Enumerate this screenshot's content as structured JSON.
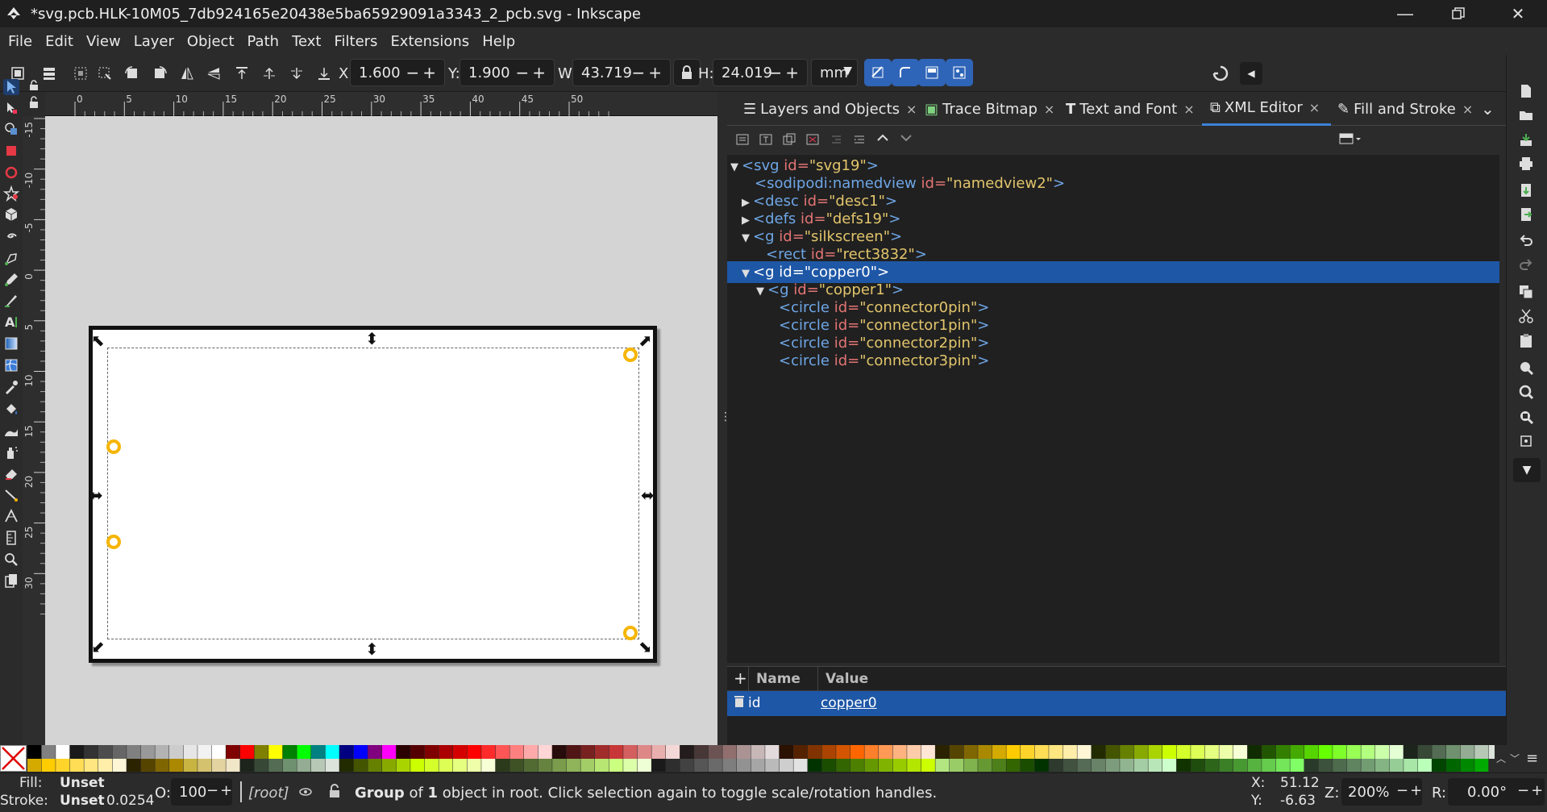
{
  "window": {
    "title": "*svg.pcb.HLK-10M05_7db924165e20438e5ba65929091a3343_2_pcb.svg - Inkscape"
  },
  "menu": [
    "File",
    "Edit",
    "View",
    "Layer",
    "Object",
    "Path",
    "Text",
    "Filters",
    "Extensions",
    "Help"
  ],
  "toolbar": {
    "x_label": "X:",
    "x_value": "1.600",
    "y_label": "Y:",
    "y_value": "1.900",
    "w_label": "W:",
    "w_value": "43.719",
    "h_label": "H:",
    "h_value": "24.019",
    "unit": "mm",
    "plusminus": "−+"
  },
  "ruler": {
    "h_ticks": [
      "0",
      "5",
      "10",
      "15",
      "20",
      "25",
      "30",
      "35",
      "40",
      "45",
      "50"
    ],
    "v_ticks": [
      "-15",
      "-10",
      "-5",
      "0",
      "5",
      "10",
      "15",
      "20",
      "25",
      "30"
    ]
  },
  "dock": {
    "tabs": [
      {
        "label": "Layers and Objects",
        "icon": "layers-icon"
      },
      {
        "label": "Trace Bitmap",
        "icon": "trace-bitmap-icon"
      },
      {
        "label": "Text and Font",
        "icon": "text-font-icon"
      },
      {
        "label": "XML Editor",
        "icon": "xml-editor-icon",
        "active": true
      },
      {
        "label": "Fill and Stroke",
        "icon": "fill-stroke-icon"
      }
    ],
    "close_glyph": "×",
    "more_glyph": "⌄",
    "xml_tree": [
      {
        "tag": "<svg",
        "attr": "id",
        "val": "\"svg19\"",
        "end": ">",
        "arrow": "▼"
      },
      {
        "tag": "<sodipodi:namedview",
        "attr": "id",
        "val": "\"namedview2\"",
        "end": ">",
        "arrow": ""
      },
      {
        "tag": "<desc",
        "attr": "id",
        "val": "\"desc1\"",
        "end": ">",
        "arrow": "▶"
      },
      {
        "tag": "<defs",
        "attr": "id",
        "val": "\"defs19\"",
        "end": ">",
        "arrow": "▶"
      },
      {
        "tag": "<g",
        "attr": "id",
        "val": "\"silkscreen\"",
        "end": ">",
        "arrow": "▼"
      },
      {
        "tag": "<rect",
        "attr": "id",
        "val": "\"rect3832\"",
        "end": ">",
        "arrow": ""
      },
      {
        "tag": "<g",
        "attr": "id",
        "val": "\"copper0\"",
        "end": ">",
        "arrow": "▼",
        "selected": true
      },
      {
        "tag": "<g",
        "attr": "id",
        "val": "\"copper1\"",
        "end": ">",
        "arrow": "▼"
      },
      {
        "tag": "<circle",
        "attr": "id",
        "val": "\"connector0pin\"",
        "end": ">",
        "arrow": ""
      },
      {
        "tag": "<circle",
        "attr": "id",
        "val": "\"connector1pin\"",
        "end": ">",
        "arrow": ""
      },
      {
        "tag": "<circle",
        "attr": "id",
        "val": "\"connector2pin\"",
        "end": ">",
        "arrow": ""
      },
      {
        "tag": "<circle",
        "attr": "id",
        "val": "\"connector3pin\"",
        "end": ">",
        "arrow": ""
      }
    ],
    "attributes": {
      "add": "+",
      "col_name": "Name",
      "col_value": "Value",
      "rows": [
        {
          "name": "id",
          "value": "copper0"
        }
      ]
    }
  },
  "palette": {
    "row1": [
      "#000000",
      "#808080",
      "#ffffff",
      "#1a1a1a",
      "#333333",
      "#4d4d4d",
      "#666666",
      "#808080",
      "#999999",
      "#b3b3b3",
      "#cccccc",
      "#e6e6e6",
      "#f2f2f2",
      "#ffffff",
      "#800000",
      "#ff0000",
      "#808000",
      "#ffff00",
      "#008000",
      "#00ff00",
      "#008080",
      "#00ffff",
      "#000080",
      "#0000ff",
      "#800080",
      "#ff00ff",
      "#2b0000",
      "#550000",
      "#800000",
      "#aa0000",
      "#d40000",
      "#ff0000",
      "#ff2a2a",
      "#ff5555",
      "#ff8080",
      "#ffaaaa",
      "#ffd5d5",
      "#280b0b",
      "#501616",
      "#782121",
      "#a02c2c",
      "#c83737",
      "#d35f5f",
      "#de8787",
      "#e9afaf",
      "#f4d7d7",
      "#241c1c",
      "#483737",
      "#6c5353",
      "#916f6f",
      "#ac9393",
      "#c8b7b7",
      "#e3dbdb",
      "#2b1100",
      "#552200",
      "#803300",
      "#aa4400",
      "#d45500",
      "#ff6600",
      "#ff7f2a",
      "#ff9955",
      "#ffb380",
      "#ffccaa",
      "#ffe6d5",
      "#2b2200",
      "#554400",
      "#806600",
      "#aa8800",
      "#d4aa00",
      "#ffcc00",
      "#ffd42a",
      "#ffdd55",
      "#ffe680",
      "#ffeeaa",
      "#fff6d5",
      "#222b00",
      "#445500",
      "#668000",
      "#88aa00",
      "#aad400",
      "#ccff00",
      "#d4ff2a",
      "#ddff55",
      "#e5ff80",
      "#eeffaa",
      "#f6ffd5",
      "#112b00",
      "#225500",
      "#338000",
      "#44aa00",
      "#55d400",
      "#66ff00",
      "#7fff2a",
      "#99ff55",
      "#b3ff80",
      "#ccffaa",
      "#e5ffd5",
      "#1c241c",
      "#374837",
      "#536c53",
      "#6f916f",
      "#93ac93",
      "#b7c8b7",
      "#dbe3db",
      "#002b00",
      "#005500",
      "#008000",
      "#00aa00"
    ],
    "row2": [
      "#d4aa00",
      "#ffcc00",
      "#ffd42a",
      "#ffdd55",
      "#ffe680",
      "#ffeeaa",
      "#fff6d5",
      "#2b2200",
      "#554400",
      "#806600",
      "#aa8800",
      "#c8b440",
      "#d4c26e",
      "#e2d3a0",
      "#f0e6c8",
      "#1c241c",
      "#374837",
      "#536c53",
      "#6f916f",
      "#93ac93",
      "#b7c8b7",
      "#dbe3db",
      "#222b00",
      "#445500",
      "#668000",
      "#88aa00",
      "#aad400",
      "#ccff00",
      "#d4ff2a",
      "#ddff55",
      "#e5ff80",
      "#eeffaa",
      "#f6ffd5",
      "#2a3a1a",
      "#3e5226",
      "#526b33",
      "#66833f",
      "#7a9c4c",
      "#8fb459",
      "#a3cd66",
      "#b7e673",
      "#cbff80",
      "#dcffaa",
      "#eeffd5",
      "#1a1a1a",
      "#2e2e2e",
      "#424242",
      "#565656",
      "#6a6a6a",
      "#7e7e7e",
      "#929292",
      "#a6a6a6",
      "#bababa",
      "#cecece",
      "#e2e2e2",
      "#003300",
      "#1a4d00",
      "#336600",
      "#4d8000",
      "#669900",
      "#80b300",
      "#99cc00",
      "#b3e600",
      "#ccff00",
      "#b3e680",
      "#99cc66",
      "#80b34d",
      "#669933",
      "#4d801a",
      "#336600",
      "#1a4d00",
      "#003300",
      "#2d3a2d",
      "#415241",
      "#556b55",
      "#698369",
      "#7d9c7d",
      "#91b491",
      "#a5cda5",
      "#b9e6b9",
      "#cdffcd",
      "#113300",
      "#1f4d0d",
      "#2d661a",
      "#3b8026",
      "#499933",
      "#57b340",
      "#65cc4d",
      "#73e659",
      "#81ff66",
      "#2a3a2a",
      "#3c523c",
      "#4e6b4e",
      "#608360",
      "#729c72",
      "#84b484",
      "#96cd96",
      "#a8e6a8",
      "#baffba",
      "#004400",
      "#006600",
      "#008800",
      "#00aa00"
    ]
  },
  "status": {
    "fill_label": "Fill:",
    "fill_value": "Unset",
    "stroke_label": "Stroke:",
    "stroke_value": "Unset",
    "stroke_width": "0.0254",
    "opacity_label": "O:",
    "opacity_value": "100",
    "layer": "[root]",
    "message_bold1": "Group",
    "message_mid1": " of ",
    "message_bold2": "1",
    "message_rest": " object in root. Click selection again to toggle scale/rotation handles.",
    "cursor_x_label": "X:",
    "cursor_x": "51.12",
    "cursor_y_label": "Y:",
    "cursor_y": "-6.63",
    "zoom_label": "Z:",
    "zoom": "200%",
    "rotate_label": "R:",
    "rotate": "0.00°"
  }
}
